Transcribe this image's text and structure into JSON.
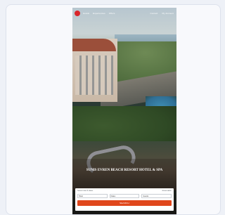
{
  "header": {
    "nav_items": [
      "Hotels",
      "Experiences",
      "Offers"
    ],
    "utility_items": [
      "Contact",
      "My Account"
    ]
  },
  "hero": {
    "title": "SUNIS EVREN BEACH RESORT HOTEL & SPA"
  },
  "booking": {
    "heading": "Select hotel & dates",
    "sub_heading": "Reservation",
    "fields": [
      "Hotel",
      "Dates",
      "Guests"
    ],
    "search_label": "SEARCH"
  },
  "colors": {
    "accent": "#e0471c",
    "logo": "#d9262b"
  }
}
